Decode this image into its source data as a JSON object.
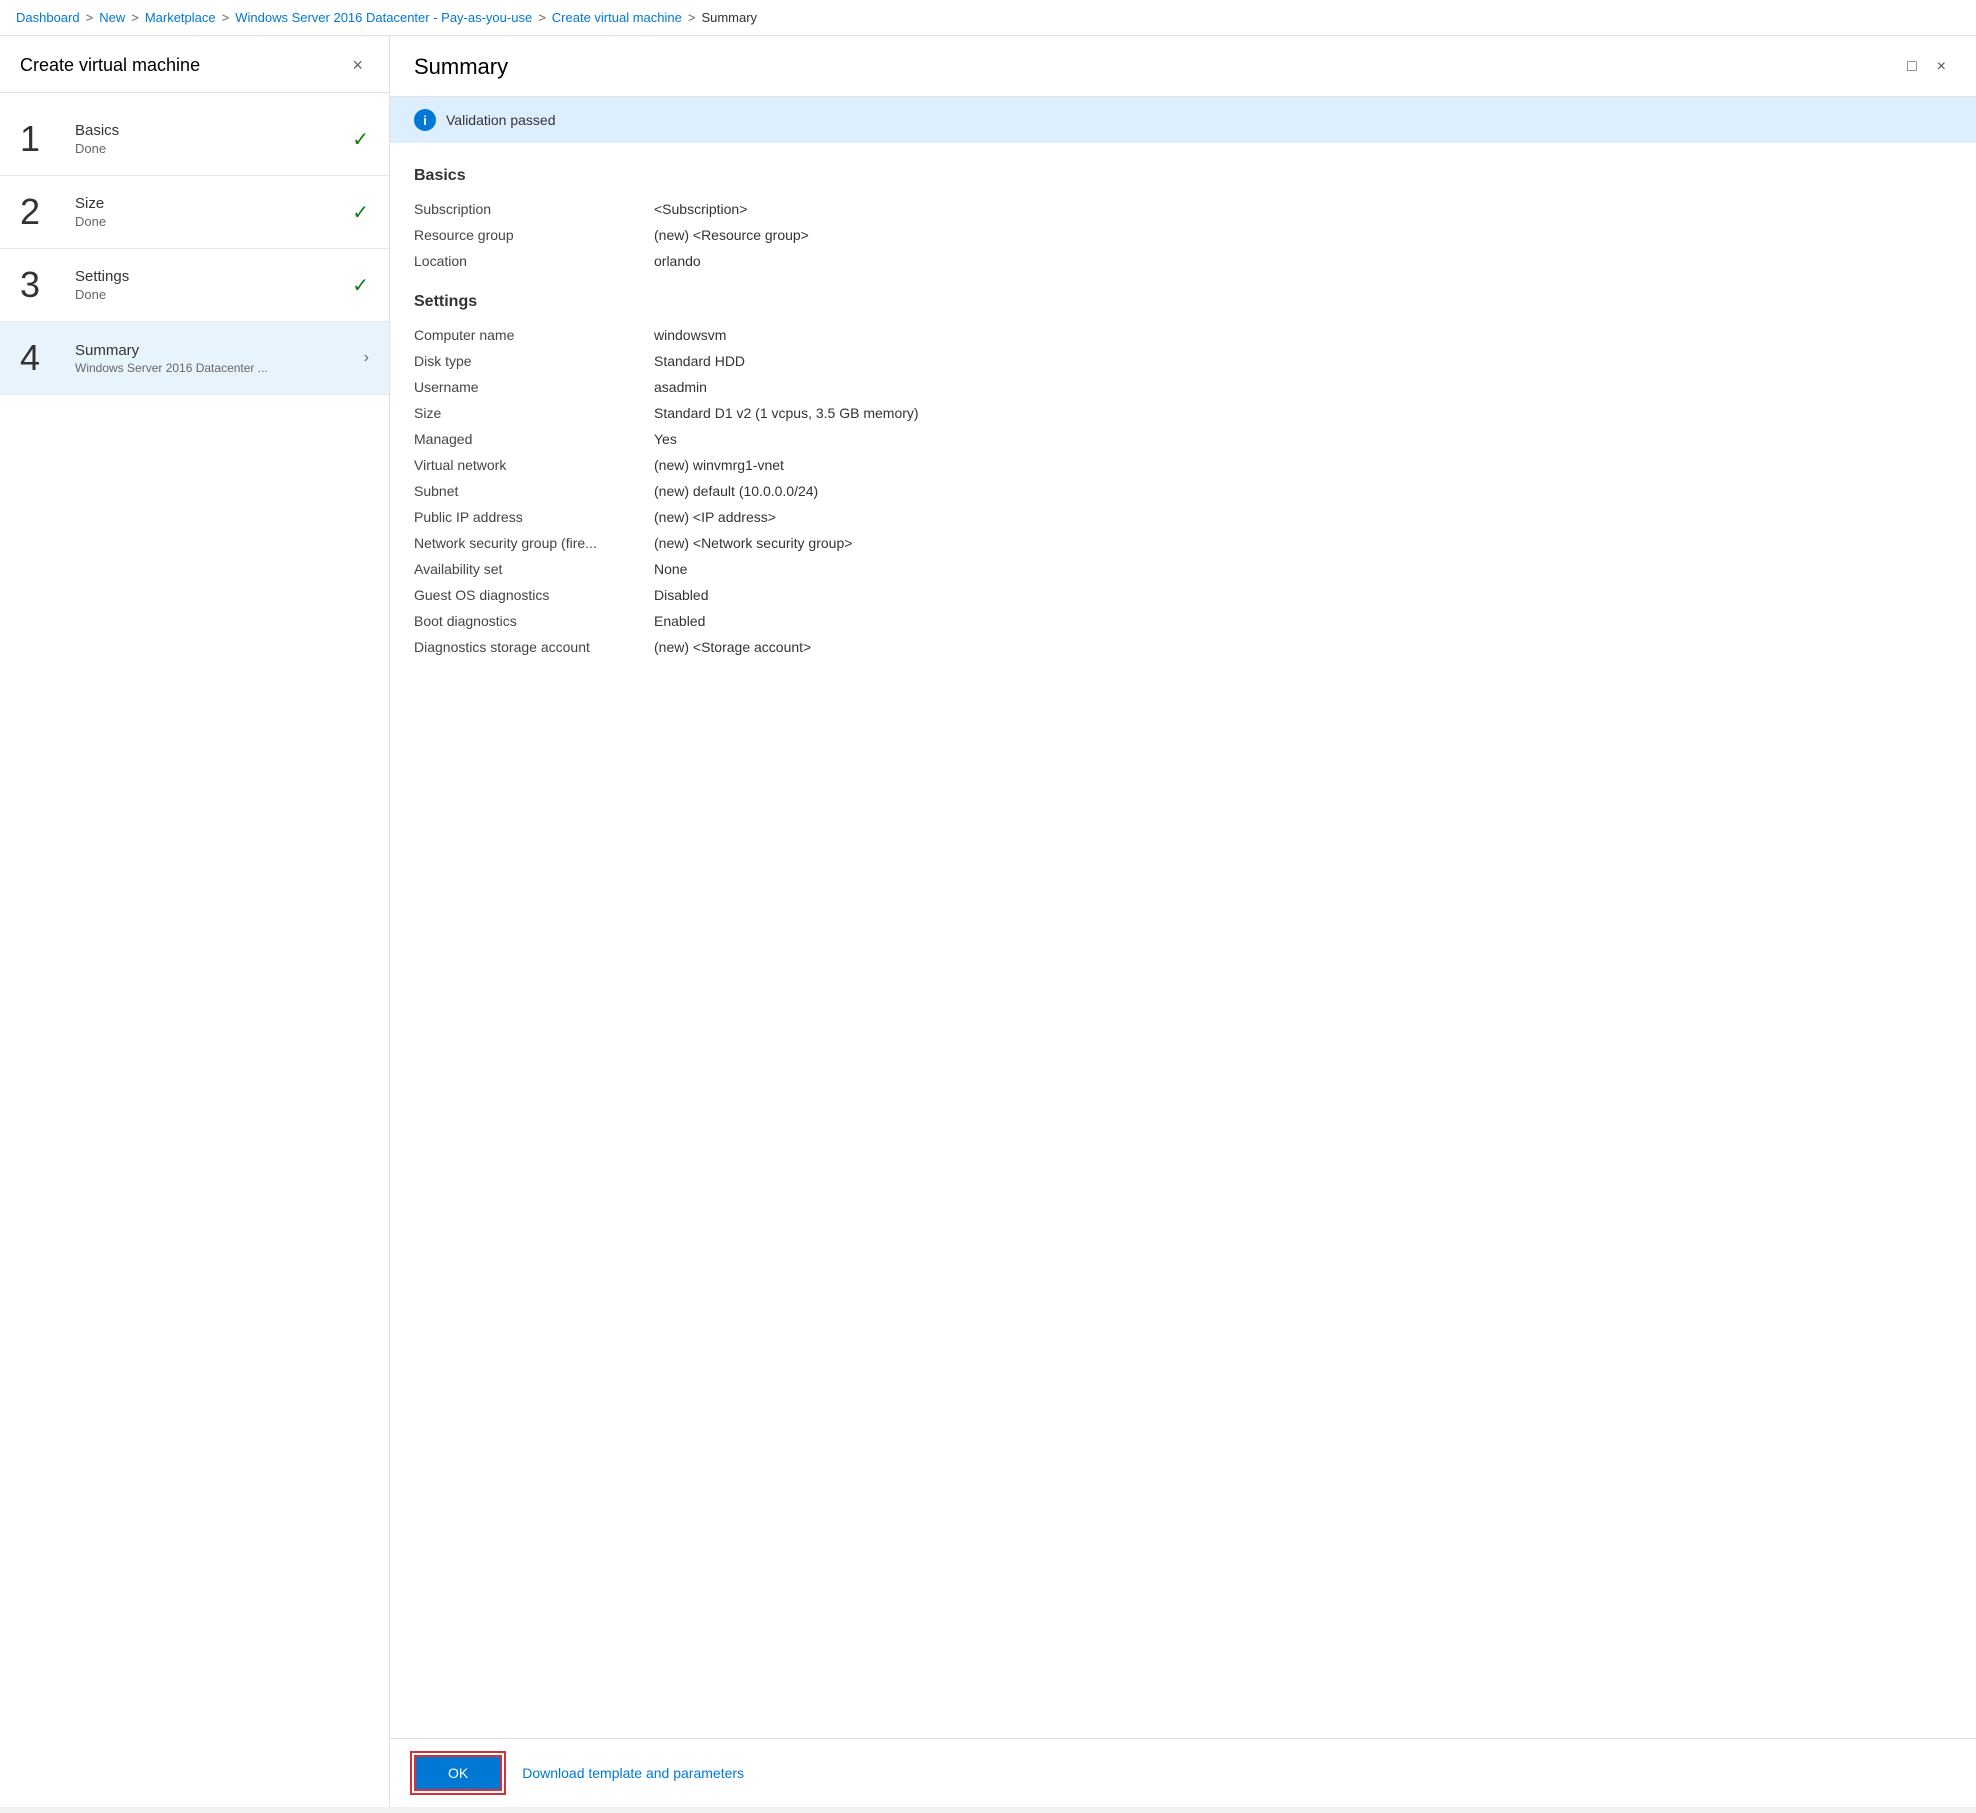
{
  "breadcrumb": {
    "items": [
      {
        "label": "Dashboard",
        "link": true
      },
      {
        "label": "New",
        "link": true
      },
      {
        "label": "Marketplace",
        "link": true
      },
      {
        "label": "Windows Server 2016 Datacenter - Pay-as-you-use",
        "link": true
      },
      {
        "label": "Create virtual machine",
        "link": true
      },
      {
        "label": "Summary",
        "link": false
      }
    ],
    "separators": [
      ">",
      ">",
      ">",
      ">",
      ">"
    ]
  },
  "left_panel": {
    "title": "Create virtual machine",
    "close_icon": "×",
    "steps": [
      {
        "number": "1",
        "name": "Basics",
        "status": "Done",
        "check": true,
        "active": false,
        "subtitle": null,
        "arrow": false
      },
      {
        "number": "2",
        "name": "Size",
        "status": "Done",
        "check": true,
        "active": false,
        "subtitle": null,
        "arrow": false
      },
      {
        "number": "3",
        "name": "Settings",
        "status": "Done",
        "check": true,
        "active": false,
        "subtitle": null,
        "arrow": false
      },
      {
        "number": "4",
        "name": "Summary",
        "status": "Windows Server 2016 Datacenter ...",
        "check": false,
        "active": true,
        "subtitle": "Windows Server 2016 Datacenter ...",
        "arrow": true
      }
    ]
  },
  "right_panel": {
    "title": "Summary",
    "maximize_icon": "□",
    "close_icon": "×",
    "validation": {
      "icon": "i",
      "message": "Validation passed"
    },
    "sections": [
      {
        "title": "Basics",
        "rows": [
          {
            "label": "Subscription",
            "value": "<Subscription>"
          },
          {
            "label": "Resource group",
            "value": "(new) <Resource group>"
          },
          {
            "label": "Location",
            "value": "orlando"
          }
        ]
      },
      {
        "title": "Settings",
        "rows": [
          {
            "label": "Computer name",
            "value": "windowsvm"
          },
          {
            "label": "Disk type",
            "value": "Standard HDD"
          },
          {
            "label": "Username",
            "value": "asadmin"
          },
          {
            "label": "Size",
            "value": "Standard D1 v2 (1 vcpus, 3.5 GB memory)"
          },
          {
            "label": "Managed",
            "value": "Yes"
          },
          {
            "label": "Virtual network",
            "value": "(new) winvmrg1-vnet"
          },
          {
            "label": "Subnet",
            "value": "(new) default (10.0.0.0/24)"
          },
          {
            "label": "Public IP address",
            "value": "(new) <IP address>"
          },
          {
            "label": "Network security group (fire...",
            "value": "(new) <Network security group>"
          },
          {
            "label": "Availability set",
            "value": "None"
          },
          {
            "label": "Guest OS diagnostics",
            "value": "Disabled"
          },
          {
            "label": "Boot diagnostics",
            "value": "Enabled"
          },
          {
            "label": "Diagnostics storage account",
            "value": "(new) <Storage account>"
          }
        ]
      }
    ],
    "footer": {
      "ok_label": "OK",
      "download_label": "Download template and parameters"
    }
  }
}
